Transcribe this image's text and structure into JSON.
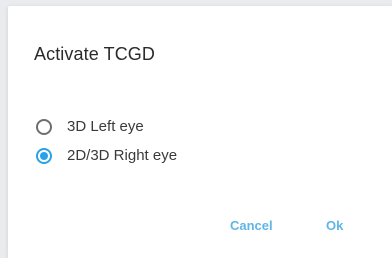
{
  "dialog": {
    "title": "Activate TCGD",
    "options": [
      {
        "label": "3D Left eye",
        "selected": false
      },
      {
        "label": "2D/3D Right eye",
        "selected": true
      }
    ],
    "buttons": {
      "cancel_label": "Cancel",
      "ok_label": "Ok"
    }
  },
  "colors": {
    "accent": "#2aa2e8",
    "button_text": "#5fb6e6",
    "title_text": "#2b2b2b"
  },
  "icons": {
    "option_unselected": "radio-unchecked-icon",
    "option_selected": "radio-checked-icon"
  }
}
